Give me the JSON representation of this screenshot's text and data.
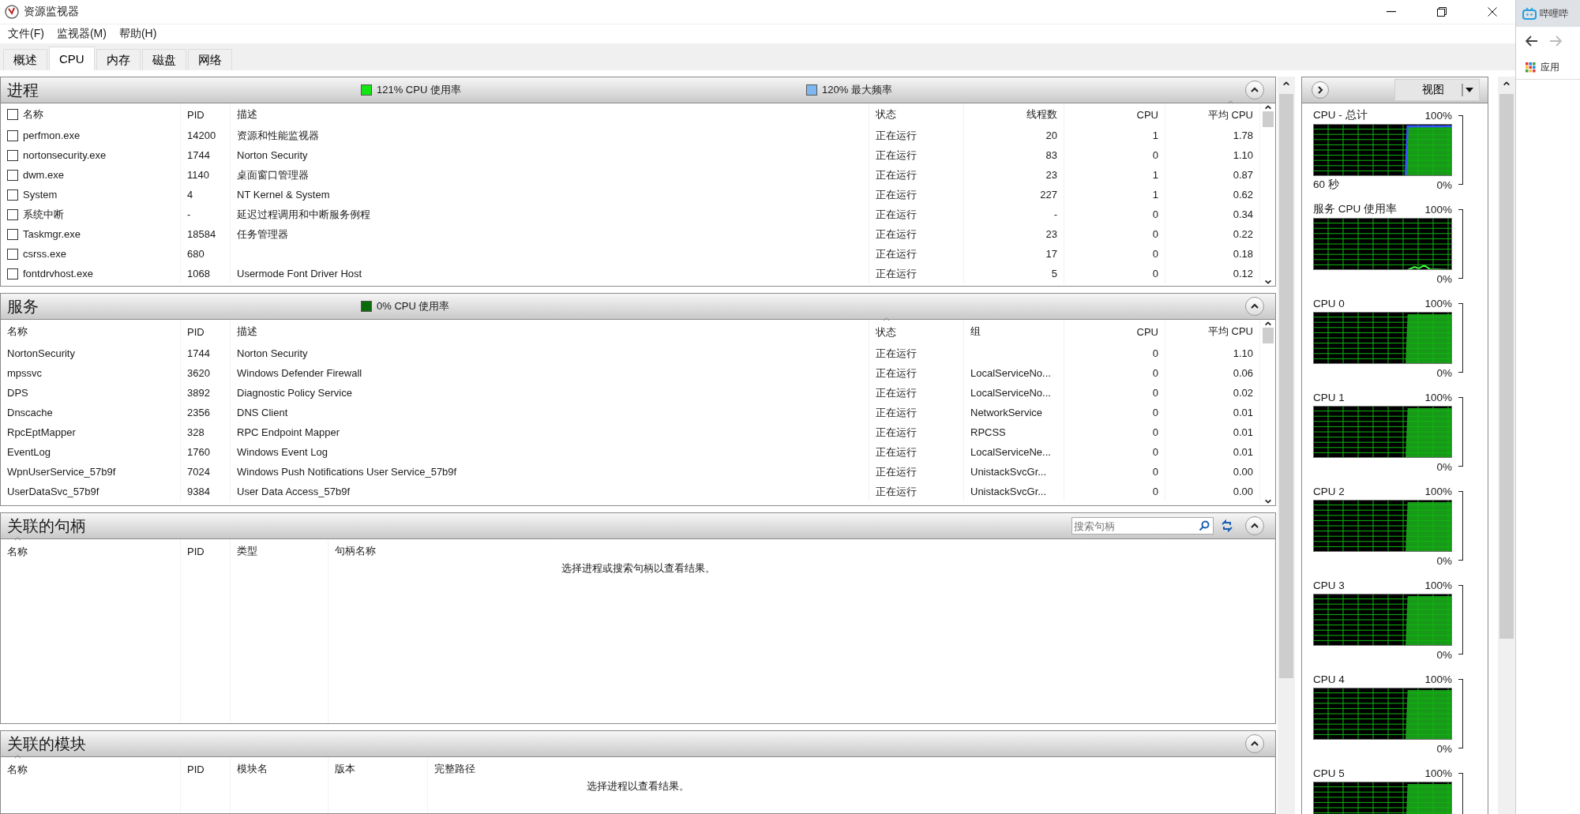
{
  "window": {
    "title": "资源监视器"
  },
  "menu": [
    "文件(F)",
    "监视器(M)",
    "帮助(H)"
  ],
  "tabs": [
    {
      "label": "概述",
      "selected": false
    },
    {
      "label": "CPU",
      "selected": true
    },
    {
      "label": "内存",
      "selected": false
    },
    {
      "label": "磁盘",
      "selected": false
    },
    {
      "label": "网络",
      "selected": false
    }
  ],
  "processes": {
    "title": "进程",
    "select_all_checked": false,
    "indicators": [
      {
        "text": "121% CPU 使用率",
        "color": "#14e614"
      },
      {
        "text": "120% 最大频率",
        "color": "#7fb8f0"
      }
    ],
    "columns": [
      {
        "label": "名称",
        "sorted": false
      },
      {
        "label": "PID",
        "sorted": false
      },
      {
        "label": "描述",
        "sorted": false
      },
      {
        "label": "状态",
        "sorted": false
      },
      {
        "label": "线程数",
        "sorted": false
      },
      {
        "label": "CPU",
        "sorted": false
      },
      {
        "label": "平均 CPU",
        "sorted": true
      }
    ],
    "rows": [
      {
        "checked": false,
        "cells": [
          "perfmon.exe",
          "14200",
          "资源和性能监视器",
          "正在运行",
          "20",
          "1",
          "1.78"
        ]
      },
      {
        "checked": false,
        "cells": [
          "nortonsecurity.exe",
          "1744",
          "Norton Security",
          "正在运行",
          "83",
          "0",
          "1.10"
        ]
      },
      {
        "checked": false,
        "cells": [
          "dwm.exe",
          "1140",
          "桌面窗口管理器",
          "正在运行",
          "23",
          "1",
          "0.87"
        ]
      },
      {
        "checked": false,
        "cells": [
          "System",
          "4",
          "NT Kernel & System",
          "正在运行",
          "227",
          "1",
          "0.62"
        ]
      },
      {
        "checked": false,
        "cells": [
          "系统中断",
          "-",
          "延迟过程调用和中断服务例程",
          "正在运行",
          "-",
          "0",
          "0.34"
        ]
      },
      {
        "checked": false,
        "cells": [
          "Taskmgr.exe",
          "18584",
          "任务管理器",
          "正在运行",
          "23",
          "0",
          "0.22"
        ]
      },
      {
        "checked": false,
        "cells": [
          "csrss.exe",
          "680",
          null,
          "正在运行",
          "17",
          "0",
          "0.18"
        ]
      },
      {
        "checked": false,
        "cells": [
          "fontdrvhost.exe",
          "1068",
          "Usermode Font Driver Host",
          "正在运行",
          "5",
          "0",
          "0.12"
        ]
      }
    ]
  },
  "services": {
    "title": "服务",
    "indicators": [
      {
        "text": "0% CPU 使用率",
        "color": "#0b6b0b"
      }
    ],
    "columns": [
      {
        "label": "名称",
        "sorted": false
      },
      {
        "label": "PID",
        "sorted": false
      },
      {
        "label": "描述",
        "sorted": false
      },
      {
        "label": "状态",
        "sorted": true
      },
      {
        "label": "组",
        "sorted": false
      },
      {
        "label": "CPU",
        "sorted": false
      },
      {
        "label": "平均 CPU",
        "sorted": false
      }
    ],
    "rows": [
      {
        "cells": [
          "NortonSecurity",
          "1744",
          "Norton Security",
          "正在运行",
          null,
          "0",
          "1.10"
        ]
      },
      {
        "cells": [
          "mpssvc",
          "3620",
          "Windows Defender Firewall",
          "正在运行",
          "LocalServiceNo...",
          "0",
          "0.06"
        ]
      },
      {
        "cells": [
          "DPS",
          "3892",
          "Diagnostic Policy Service",
          "正在运行",
          "LocalServiceNo...",
          "0",
          "0.02"
        ]
      },
      {
        "cells": [
          "Dnscache",
          "2356",
          "DNS Client",
          "正在运行",
          "NetworkService",
          "0",
          "0.01"
        ]
      },
      {
        "cells": [
          "RpcEptMapper",
          "328",
          "RPC Endpoint Mapper",
          "正在运行",
          "RPCSS",
          "0",
          "0.01"
        ]
      },
      {
        "cells": [
          "EventLog",
          "1760",
          "Windows Event Log",
          "正在运行",
          "LocalServiceNe...",
          "0",
          "0.01"
        ]
      },
      {
        "cells": [
          "WpnUserService_57b9f",
          "7024",
          "Windows Push Notifications User Service_57b9f",
          "正在运行",
          "UnistackSvcGr...",
          "0",
          "0.00"
        ]
      },
      {
        "cells": [
          "UserDataSvc_57b9f",
          "9384",
          "User Data Access_57b9f",
          "正在运行",
          "UnistackSvcGr...",
          "0",
          "0.00"
        ]
      }
    ]
  },
  "handles": {
    "title": "关联的句柄",
    "search": {
      "placeholder": "搜索句柄"
    },
    "columns": [
      {
        "label": "名称",
        "sorted": true
      },
      {
        "label": "PID",
        "sorted": false
      },
      {
        "label": "类型",
        "sorted": false
      },
      {
        "label": "句柄名称",
        "sorted": false
      }
    ],
    "message": "选择进程或搜索句柄以查看结果。"
  },
  "modules": {
    "title": "关联的模块",
    "columns": [
      {
        "label": "名称",
        "sorted": true
      },
      {
        "label": "PID",
        "sorted": false
      },
      {
        "label": "模块名",
        "sorted": false
      },
      {
        "label": "版本",
        "sorted": false
      },
      {
        "label": "完整路径",
        "sorted": false
      }
    ],
    "message": "选择进程以查看结果。"
  },
  "side_panel": {
    "view_button": "视图",
    "graphs": [
      {
        "title": "CPU - 总计",
        "max": "100%",
        "time": "60 秒",
        "min": "0%",
        "kind": "total"
      },
      {
        "title": "服务 CPU 使用率",
        "max": "100%",
        "min": "0%",
        "kind": "idle"
      },
      {
        "title": "CPU 0",
        "max": "100%",
        "min": "0%",
        "kind": "busy"
      },
      {
        "title": "CPU 1",
        "max": "100%",
        "min": "0%",
        "kind": "busy"
      },
      {
        "title": "CPU 2",
        "max": "100%",
        "min": "0%",
        "kind": "busy"
      },
      {
        "title": "CPU 3",
        "max": "100%",
        "min": "0%",
        "kind": "busy"
      },
      {
        "title": "CPU 4",
        "max": "100%",
        "min": "0%",
        "kind": "busy"
      },
      {
        "title": "CPU 5",
        "max": "100%",
        "kind": "busy"
      }
    ]
  },
  "browser": {
    "tab_title": "哔哩哔",
    "bookmark": "应用"
  }
}
